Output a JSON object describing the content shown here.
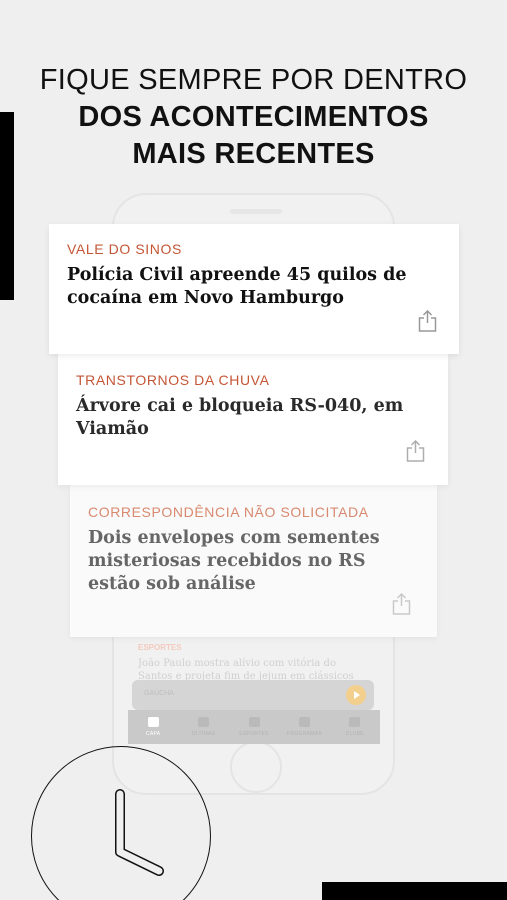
{
  "headline": {
    "line1": "FIQUE SEMPRE POR DENTRO",
    "line2_prefix": "DOS ",
    "line2_bold": "ACONTECIMENTOS",
    "line3": "MAIS RECENTES"
  },
  "cards": [
    {
      "section": "VALE DO SINOS",
      "title": "Polícia Civil apreende 45 quilos de cocaína em Novo Hamburgo"
    },
    {
      "section": "TRANSTORNOS DA CHUVA",
      "title": "Árvore cai e bloqueia RS-040, em Viamão"
    },
    {
      "section": "CORRESPONDÊNCIA NÃO SOLICITADA",
      "title": "Dois envelopes com sementes misteriosas recebidos no RS estão sob análise"
    }
  ],
  "phone": {
    "story_section": "ESPORTES",
    "story_title": "João Paulo mostra alívio com vitória do Santos e projeta fim de jejum em clássicos",
    "player_text": "GAÚCHA",
    "tabs": [
      {
        "label": "CAPA",
        "icon": "home-icon"
      },
      {
        "label": "ÚLTIMAS",
        "icon": "clock-icon"
      },
      {
        "label": "ESPORTES",
        "icon": "ball-icon"
      },
      {
        "label": "PROGRAMAS",
        "icon": "video-icon"
      },
      {
        "label": "CLUBE",
        "icon": "club-icon"
      }
    ]
  },
  "colors": {
    "section_accent": "#c45636",
    "background": "#efefef"
  }
}
